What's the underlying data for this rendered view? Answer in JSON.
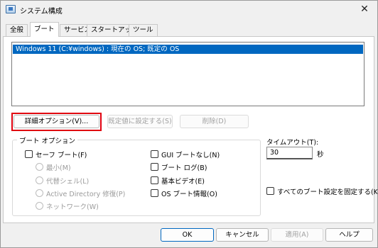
{
  "window": {
    "title": "システム構成",
    "close": "✕"
  },
  "tabs": [
    "全般",
    "ブート",
    "サービス",
    "スタートアップ",
    "ツール"
  ],
  "os_list": {
    "entries": [
      "Windows 11 (C:¥windows) : 現在の OS; 既定の OS"
    ]
  },
  "buttons": {
    "advanced": "詳細オプション(V)...",
    "set_default": "既定値に設定する(S)",
    "delete": "削除(D)"
  },
  "boot_options": {
    "legend": "ブート オプション",
    "safe_boot": "セーフ ブート(F)",
    "minimal": "最小(M)",
    "alternate_shell": "代替シェル(L)",
    "ad_repair": "Active Directory 修復(P)",
    "network": "ネットワーク(W)",
    "no_gui_boot": "GUI ブートなし(N)",
    "boot_log": "ブート ログ(B)",
    "base_video": "基本ビデオ(E)",
    "os_boot_info": "OS ブート情報(O)"
  },
  "timeout": {
    "label": "タイムアウト(T):",
    "value": "30",
    "unit": "秒"
  },
  "make_permanent": "すべてのブート設定を固定する(K)",
  "footer": {
    "ok": "OK",
    "cancel": "キャンセル",
    "apply": "適用(A)",
    "help": "ヘルプ"
  }
}
